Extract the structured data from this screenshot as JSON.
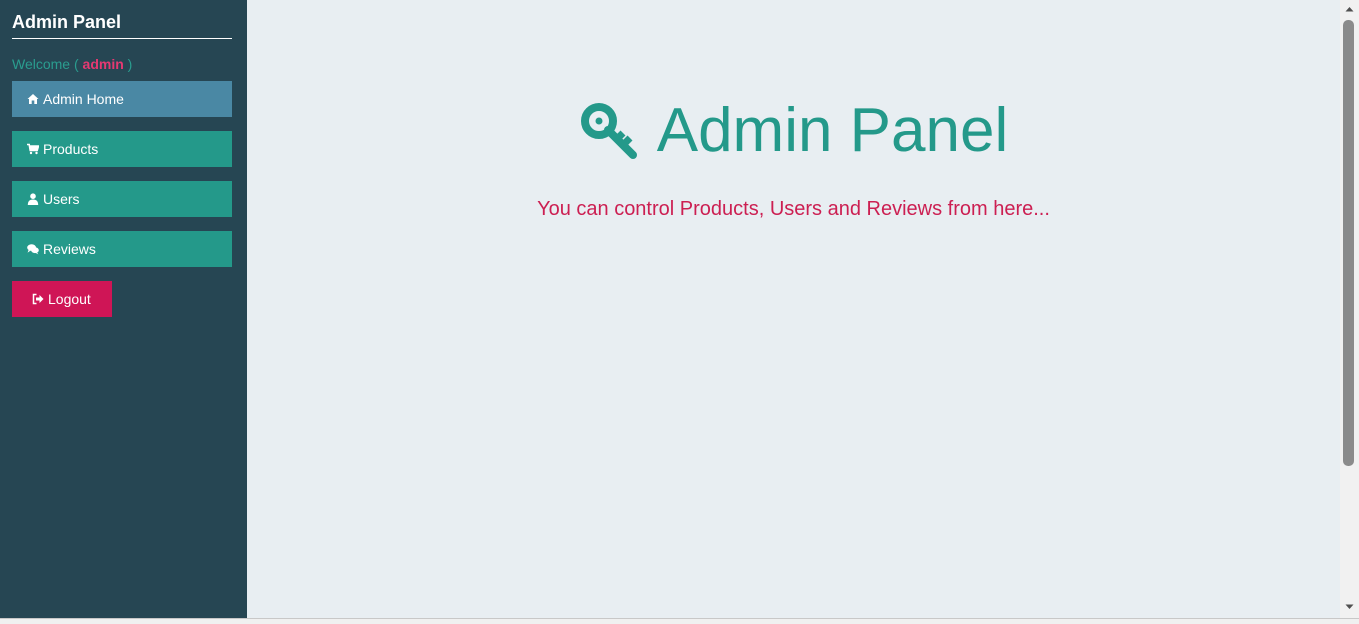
{
  "sidebar": {
    "title": "Admin Panel",
    "welcome_prefix": "Welcome (",
    "username": "admin",
    "welcome_suffix": ")",
    "nav": [
      {
        "label": "Admin Home",
        "icon": "home-icon"
      },
      {
        "label": "Products",
        "icon": "cart-icon"
      },
      {
        "label": "Users",
        "icon": "user-icon"
      },
      {
        "label": "Reviews",
        "icon": "comments-icon"
      }
    ],
    "logout_label": "Logout",
    "logout_icon": "logout-icon"
  },
  "main": {
    "title": "Admin Panel",
    "title_icon": "key-icon",
    "subtitle": "You can control Products, Users and Reviews from here..."
  },
  "colors": {
    "sidebar_bg": "#264653",
    "accent_teal": "#24998a",
    "active_nav": "#4a88a4",
    "logout": "#cf1556",
    "subtitle": "#cc1f52"
  }
}
